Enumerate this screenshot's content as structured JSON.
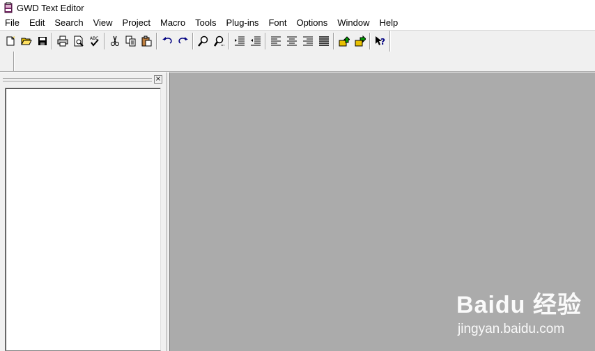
{
  "window": {
    "title": "GWD Text Editor",
    "icon": "gwd-app-icon"
  },
  "menubar": {
    "items": [
      "File",
      "Edit",
      "Search",
      "View",
      "Project",
      "Macro",
      "Tools",
      "Plug-ins",
      "Font",
      "Options",
      "Window",
      "Help"
    ]
  },
  "toolbar": {
    "groups": [
      [
        "new-file-icon",
        "open-folder-icon",
        "save-icon"
      ],
      [
        "print-icon",
        "print-preview-icon",
        "spellcheck-icon"
      ],
      [
        "cut-icon",
        "copy-icon",
        "paste-icon"
      ],
      [
        "undo-icon",
        "redo-icon"
      ],
      [
        "find-icon",
        "find-next-icon"
      ],
      [
        "indent-icon",
        "outdent-icon"
      ],
      [
        "align-left-icon",
        "align-center-icon",
        "align-right-icon",
        "justify-icon"
      ],
      [
        "project-open-icon",
        "project-save-icon"
      ],
      [
        "context-help-icon"
      ]
    ]
  },
  "left_pane": {
    "close_glyph": "×"
  },
  "watermark": {
    "logo_text": "Baidu 经验",
    "url": "jingyan.baidu.com"
  },
  "colors": {
    "mdi_background": "#ababab",
    "chrome": "#f0f0f0",
    "accent_green": "#00a000",
    "accent_yellow": "#e8c000"
  }
}
